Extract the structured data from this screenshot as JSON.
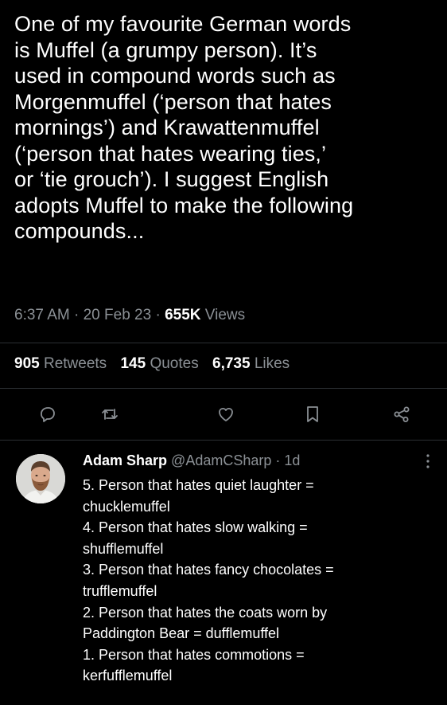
{
  "tweet": {
    "text": "One of my favourite German words\nis Muffel (a grumpy person). It’s\nused in compound words such as\nMorgenmuffel (‘person that hates\nmornings’) and Krawattenmuffel\n(‘person that hates wearing ties,’\nor ‘tie grouch’). I suggest English\nadopts Muffel to make the following\ncompounds...",
    "time": "6:37 AM",
    "date": "20 Feb 23",
    "views_count": "655K",
    "views_label": "Views",
    "separator": " · "
  },
  "stats": {
    "retweets_count": "905",
    "retweets_label": "Retweets",
    "quotes_count": "145",
    "quotes_label": "Quotes",
    "likes_count": "6,735",
    "likes_label": "Likes"
  },
  "actions": [
    "reply-icon",
    "retweet-icon",
    "like-icon",
    "bookmark-icon",
    "share-icon"
  ],
  "reply": {
    "name": "Adam Sharp",
    "handle": "@AdamCSharp",
    "time": "1d",
    "separator": " · ",
    "text": "5. Person that hates quiet laughter =\nchucklemuffel\n4. Person that hates slow walking =\nshufflemuffel\n3. Person that hates fancy chocolates =\ntrufflemuffel\n2. Person that hates the coats worn by\nPaddington Bear = dufflemuffel\n1. Person that hates commotions =\nkerfufflemuffel"
  },
  "colors": {
    "background": "#000000",
    "text": "#ffffff",
    "secondary": "#8b9095",
    "divider": "#2b2f33"
  }
}
